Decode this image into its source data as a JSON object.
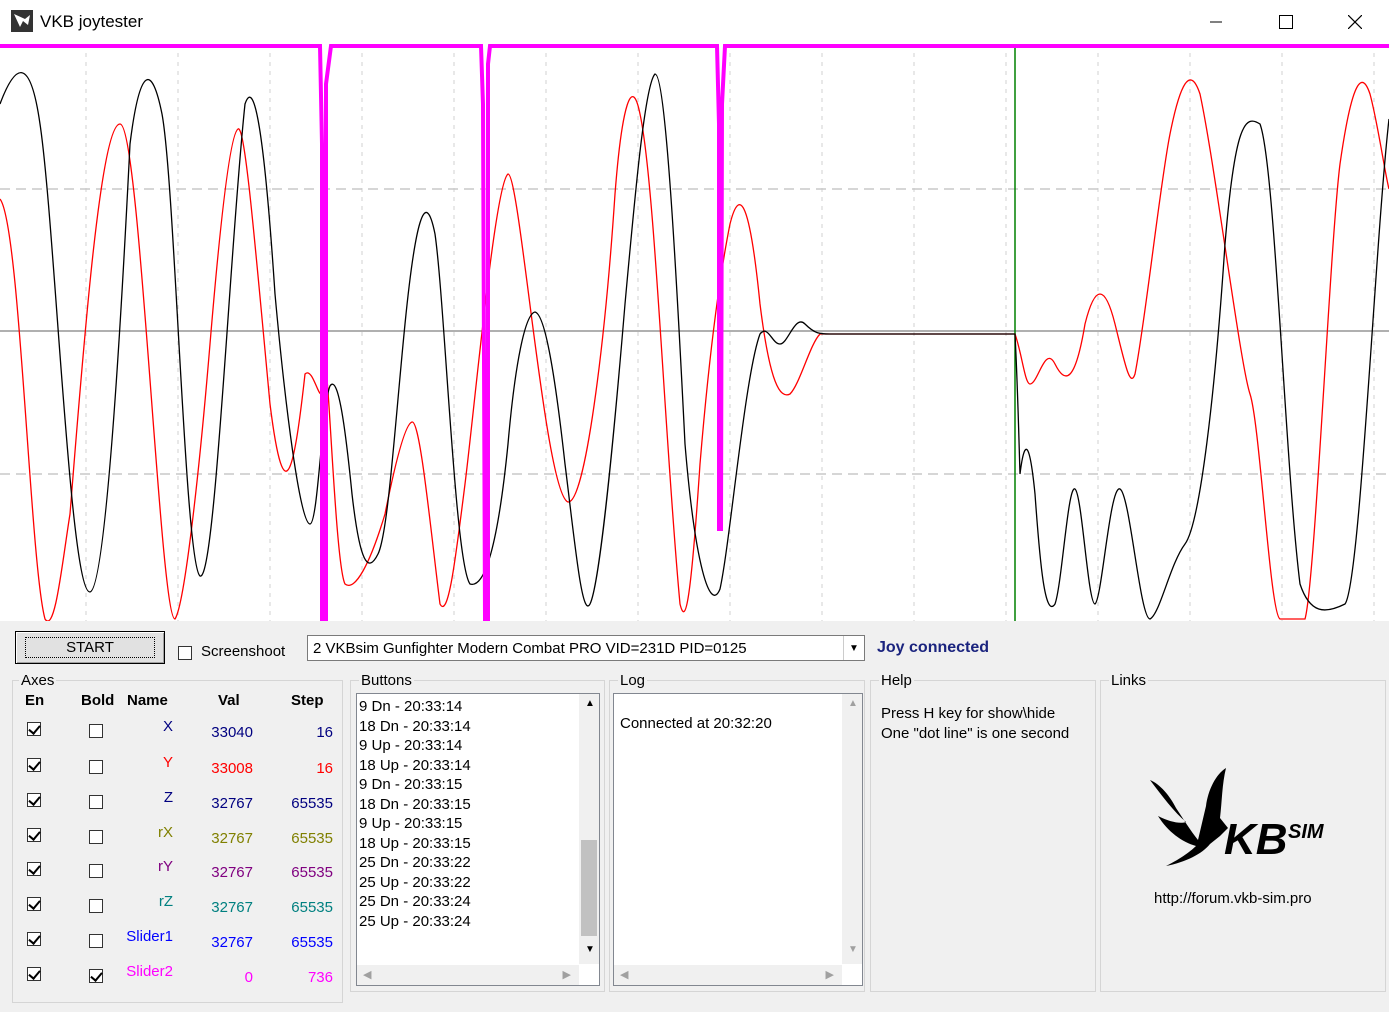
{
  "window": {
    "title": "VKB joytester"
  },
  "toolbar": {
    "start_label": "START",
    "screenshot_label": "Screenshoot",
    "screenshot_checked": false,
    "device": "2 VKBsim Gunfighter Modern Combat PRO  VID=231D PID=0125",
    "status": "Joy connected",
    "status_color": "#1a237e"
  },
  "axes": {
    "title": "Axes",
    "headers": {
      "en": "En",
      "bold": "Bold",
      "name": "Name",
      "val": "Val",
      "step": "Step"
    },
    "rows": [
      {
        "name": "X",
        "val": "33040",
        "step": "16",
        "color": "#000080",
        "en": true,
        "bold": false
      },
      {
        "name": "Y",
        "val": "33008",
        "step": "16",
        "color": "#ff0000",
        "en": true,
        "bold": false
      },
      {
        "name": "Z",
        "val": "32767",
        "step": "65535",
        "color": "#000080",
        "en": true,
        "bold": false
      },
      {
        "name": "rX",
        "val": "32767",
        "step": "65535",
        "color": "#808000",
        "en": true,
        "bold": false
      },
      {
        "name": "rY",
        "val": "32767",
        "step": "65535",
        "color": "#800080",
        "en": true,
        "bold": false
      },
      {
        "name": "rZ",
        "val": "32767",
        "step": "65535",
        "color": "#008080",
        "en": true,
        "bold": false
      },
      {
        "name": "Slider1",
        "val": "32767",
        "step": "65535",
        "color": "#0000ff",
        "en": true,
        "bold": false
      },
      {
        "name": "Slider2",
        "val": "0",
        "step": "736",
        "color": "#ff00ff",
        "en": true,
        "bold": true
      }
    ]
  },
  "buttons": {
    "title": "Buttons",
    "items": [
      "9 Dn - 20:33:14",
      "18 Dn - 20:33:14",
      "9 Up - 20:33:14",
      "18 Up - 20:33:14",
      "9 Dn - 20:33:15",
      "18 Dn - 20:33:15",
      "9 Up - 20:33:15",
      "18 Up - 20:33:15",
      "25 Dn - 20:33:22",
      "25 Up - 20:33:22",
      "25 Dn - 20:33:24",
      "25 Up - 20:33:24"
    ]
  },
  "log": {
    "title": "Log",
    "items": [
      "Connected at 20:32:20"
    ]
  },
  "help": {
    "title": "Help",
    "lines": [
      "Press H key for show\\hide",
      "One \"dot line\" is one second"
    ]
  },
  "links": {
    "title": "Links",
    "url": "http://forum.vkb-sim.pro",
    "logo_text": "KB",
    "logo_sup": "SIM"
  },
  "colors": {
    "trace_x": "#000000",
    "trace_y": "#ff0000",
    "trace_slider2": "#ff00ff",
    "marker": "#008000",
    "grid": "#c0c0c0"
  }
}
